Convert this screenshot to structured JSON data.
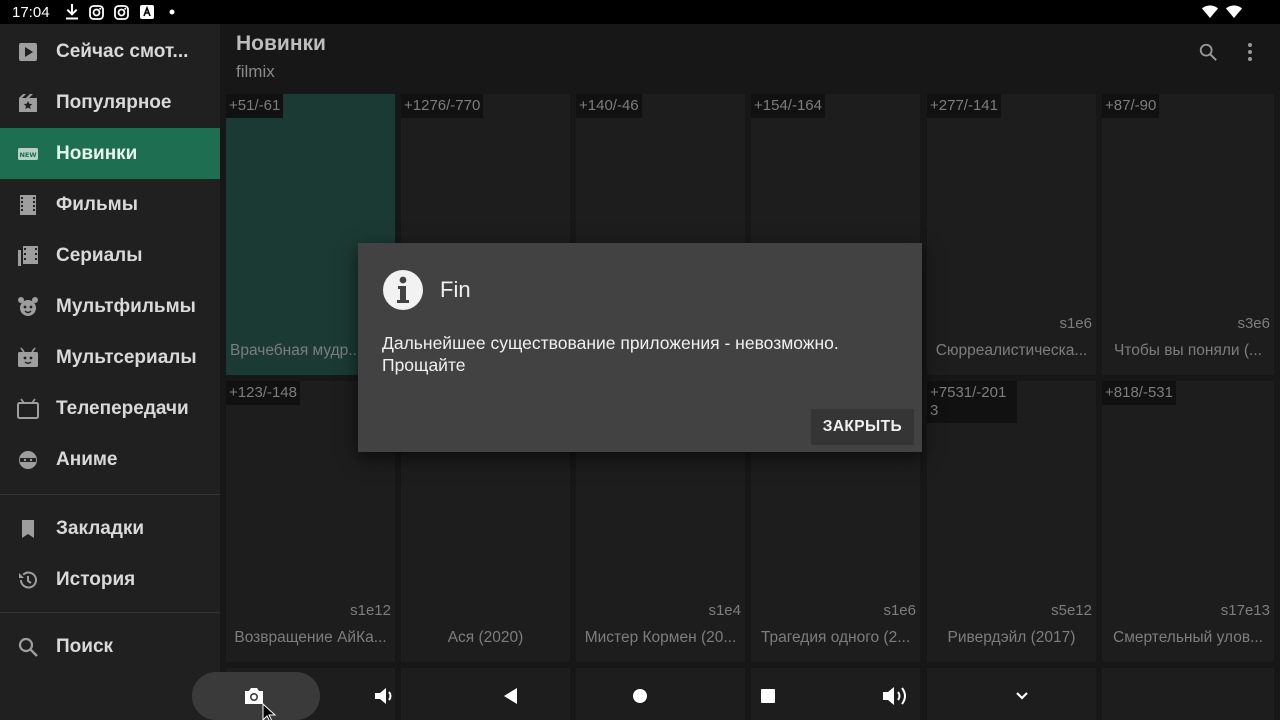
{
  "status": {
    "time": "17:04",
    "icons": [
      "download-icon",
      "instagram-icon",
      "instagram-icon",
      "app-icon",
      "dot-icon"
    ],
    "right_icons": [
      "wifi-icon",
      "wifi-icon"
    ]
  },
  "sidebar": {
    "items": [
      {
        "label": "Сейчас смот...",
        "icon": "play-icon"
      },
      {
        "label": "Популярное",
        "icon": "popular-icon"
      },
      {
        "label": "Новинки",
        "icon": "new-icon",
        "active": true
      },
      {
        "label": "Фильмы",
        "icon": "film-icon"
      },
      {
        "label": "Сериалы",
        "icon": "series-icon"
      },
      {
        "label": "Мультфильмы",
        "icon": "cartoon-icon"
      },
      {
        "label": "Мультсериалы",
        "icon": "cartoon-series-icon"
      },
      {
        "label": "Телепередачи",
        "icon": "tv-icon"
      },
      {
        "label": "Аниме",
        "icon": "anime-icon"
      },
      {
        "label": "Закладки",
        "icon": "bookmark-icon"
      },
      {
        "label": "История",
        "icon": "history-icon"
      },
      {
        "label": "Поиск",
        "icon": "search-icon"
      }
    ]
  },
  "header": {
    "title": "Новинки",
    "subtitle": "filmix"
  },
  "grid": {
    "cards": [
      {
        "rating": "+51/-61",
        "ep": "",
        "title": "Врачебная мудр..."
      },
      {
        "rating": "+1276/-770",
        "ep": "",
        "title": ""
      },
      {
        "rating": "+140/-46",
        "ep": "",
        "title": ""
      },
      {
        "rating": "+154/-164",
        "ep": "",
        "title": ""
      },
      {
        "rating": "+277/-141",
        "ep": "s1e6",
        "title": "Сюрреалистическа..."
      },
      {
        "rating": "+87/-90",
        "ep": "s3e6",
        "title": "Чтобы вы поняли (..."
      },
      {
        "rating": "+123/-148",
        "ep": "s1e12",
        "title": "Возвращение АйКа..."
      },
      {
        "rating": "",
        "ep": "",
        "title": "Ася (2020)"
      },
      {
        "rating": "",
        "ep": "s1e4",
        "title": "Мистер Кормен (20..."
      },
      {
        "rating": "",
        "ep": "s1e6",
        "title": "Трагедия одного (2..."
      },
      {
        "rating": "+7531/-2013",
        "ep": "s5e12",
        "title": "Ривердэйл (2017)"
      },
      {
        "rating": "+818/-531",
        "ep": "s17e13",
        "title": "Смертельный улов..."
      }
    ]
  },
  "dialog": {
    "title": "Fin",
    "message": "Дальнейшее существование приложения - невозможно. Прощайте",
    "button": "ЗАКРЫТЬ"
  },
  "navbar": {
    "buttons": [
      "screenshot-icon",
      "volume-down-icon",
      "back-icon",
      "home-icon",
      "recents-icon",
      "volume-up-icon",
      "collapse-icon"
    ]
  }
}
